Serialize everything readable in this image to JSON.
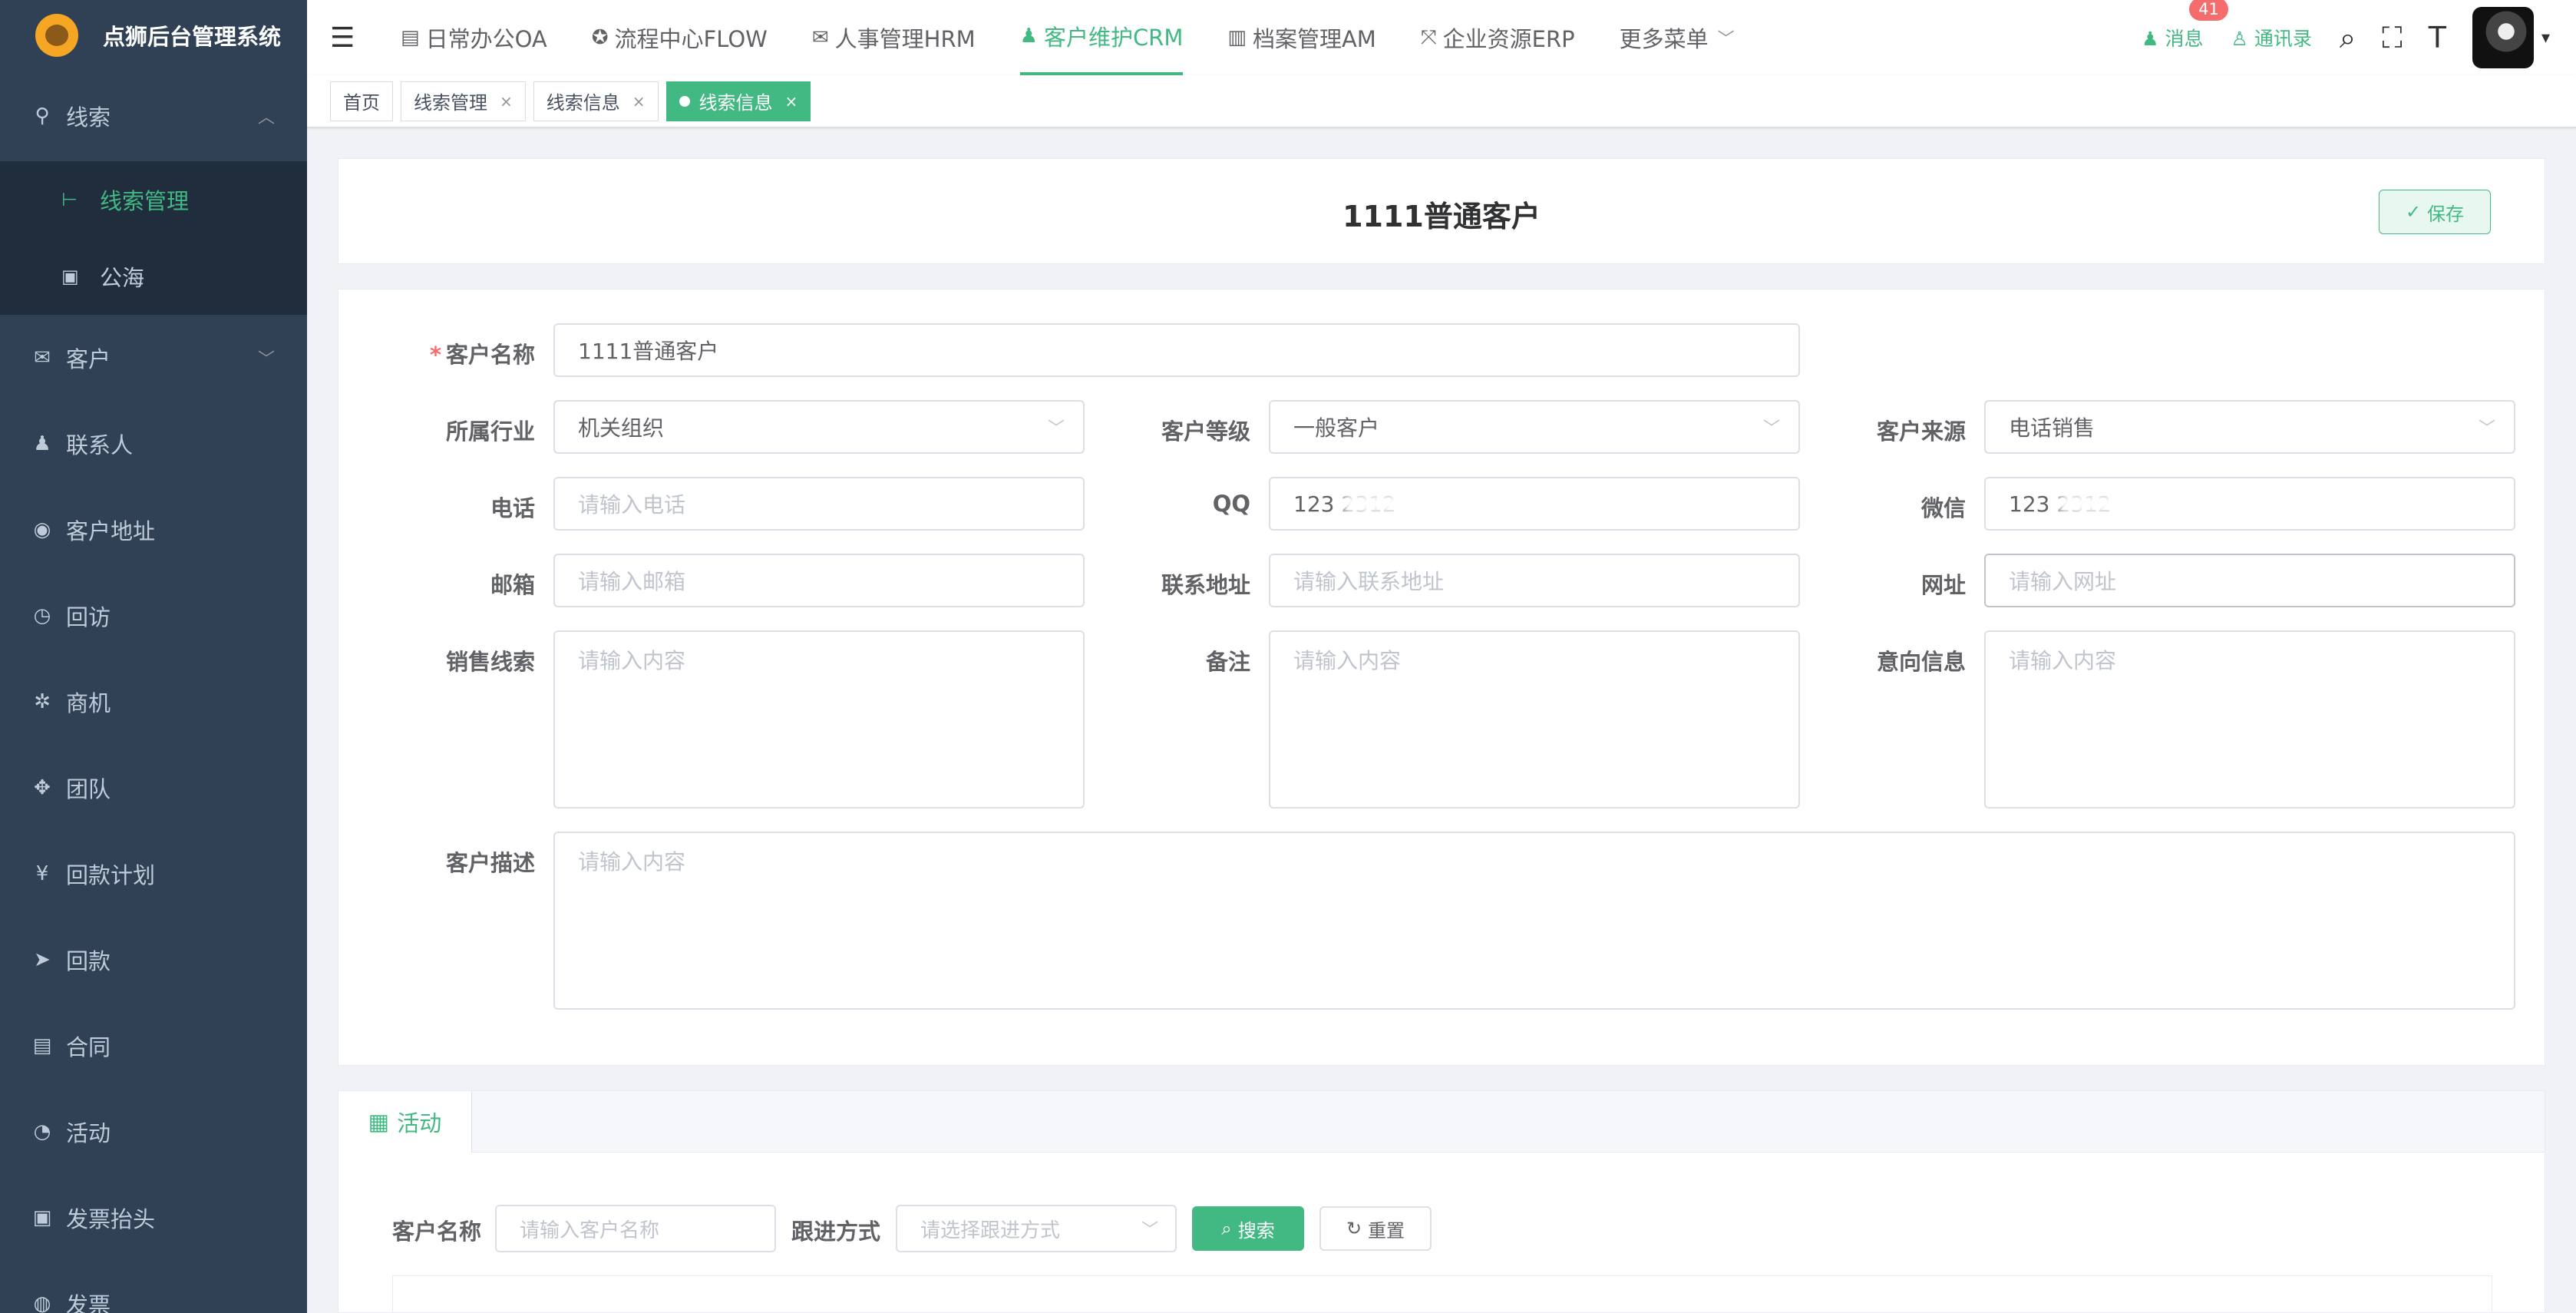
{
  "app_title": "点狮后台管理系统",
  "sidebar": {
    "items": [
      {
        "label": "线索",
        "icon": "lead-icon"
      },
      {
        "label": "线索管理",
        "icon": "tree-icon"
      },
      {
        "label": "公海",
        "icon": "sea-icon"
      },
      {
        "label": "客户",
        "icon": "wechat-icon"
      },
      {
        "label": "联系人",
        "icon": "bell-icon"
      },
      {
        "label": "客户地址",
        "icon": "globe-icon"
      },
      {
        "label": "回访",
        "icon": "clock-icon"
      },
      {
        "label": "商机",
        "icon": "bug-icon"
      },
      {
        "label": "团队",
        "icon": "team-icon"
      },
      {
        "label": "回款计划",
        "icon": "yen-icon"
      },
      {
        "label": "回款",
        "icon": "send-icon"
      },
      {
        "label": "合同",
        "icon": "document-icon"
      },
      {
        "label": "活动",
        "icon": "dashboard-icon"
      },
      {
        "label": "发票抬头",
        "icon": "invoice-icon"
      },
      {
        "label": "发票",
        "icon": "invoice2-icon"
      }
    ]
  },
  "topnav": {
    "items": [
      "日常办公OA",
      "流程中心FLOW",
      "人事管理HRM",
      "客户维护CRM",
      "档案管理AM",
      "企业资源ERP",
      "更多菜单"
    ],
    "message_label": "消息",
    "message_count": "41",
    "contacts_label": "通讯录"
  },
  "tags": [
    "首页",
    "线索管理",
    "线索信息",
    "线索信息"
  ],
  "page": {
    "title": "1111普通客户",
    "save_label": "保存"
  },
  "form": {
    "customer_name_label": "客户名称",
    "customer_name_value": "1111普通客户",
    "industry_label": "所属行业",
    "industry_value": "机关组织",
    "level_label": "客户等级",
    "level_value": "一般客户",
    "source_label": "客户来源",
    "source_value": "电话销售",
    "phone_label": "电话",
    "phone_placeholder": "请输入电话",
    "qq_label": "QQ",
    "qq_value": "123 2312",
    "wechat_label": "微信",
    "wechat_value": "123 2312",
    "email_label": "邮箱",
    "email_placeholder": "请输入邮箱",
    "address_label": "联系地址",
    "address_placeholder": "请输入联系地址",
    "website_label": "网址",
    "website_placeholder": "请输入网址",
    "sales_lead_label": "销售线索",
    "remark_label": "备注",
    "intent_label": "意向信息",
    "content_placeholder": "请输入内容",
    "description_label": "客户描述"
  },
  "activity": {
    "tab_label": "活动",
    "search_name_label": "客户名称",
    "search_name_placeholder": "请输入客户名称",
    "follow_label": "跟进方式",
    "follow_placeholder": "请选择跟进方式",
    "search_btn": "搜索",
    "reset_btn": "重置"
  }
}
